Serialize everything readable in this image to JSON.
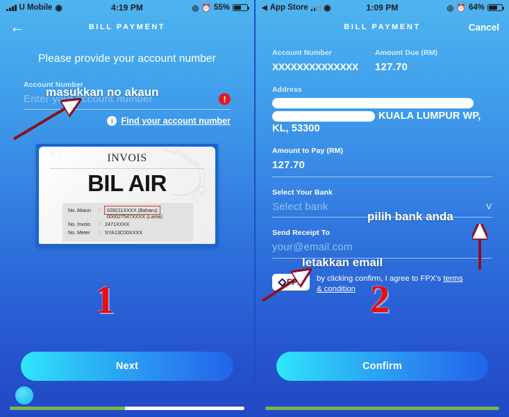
{
  "left": {
    "status": {
      "carrier": "U Mobile",
      "time": "4:19 PM",
      "battery": "55%",
      "wifi_icon": "wifi-icon",
      "signal_icon": "signal-bars-icon",
      "battery_icon": "battery-icon",
      "alarm_icon": "alarm-clock-icon",
      "lock_icon": "screen-rotation-lock-icon"
    },
    "nav": {
      "back_icon": "back-arrow-icon",
      "title": "BILL PAYMENT"
    },
    "headline": "Please provide your account number",
    "account": {
      "label": "Account Number",
      "placeholder": "Enter your account number",
      "value": "",
      "error_icon": "error-exclamation-icon"
    },
    "find_link": {
      "info_icon": "info-circle-icon",
      "text": "Find your account number"
    },
    "invoice": {
      "title": "INVOIS",
      "heading": "BIL AIR",
      "rows": [
        {
          "key": "No. Akaun",
          "sep": ":",
          "value": "028211XXXX (Baharu)",
          "value_old": "000027547XXXX (Lama)"
        },
        {
          "key": "No. Invois",
          "sep": ":",
          "value": "2471XXXX"
        },
        {
          "key": "No. Meter",
          "sep": ":",
          "value": "SYA13C00XXXX"
        }
      ]
    },
    "step_number": "1",
    "cta_label": "Next",
    "progress_percent": 49,
    "annotations": [
      {
        "text": "masukkan no akaun",
        "name": "annotation-enter-account-number"
      }
    ]
  },
  "right": {
    "status": {
      "app_back": "App Store",
      "time": "1:09 PM",
      "battery": "64%",
      "wifi_icon": "wifi-icon",
      "signal_icon": "signal-bars-icon",
      "battery_icon": "battery-icon",
      "alarm_icon": "alarm-clock-icon",
      "lock_icon": "screen-rotation-lock-icon",
      "back_triangle_icon": "back-triangle-icon"
    },
    "nav": {
      "title": "BILL PAYMENT",
      "cancel_label": "Cancel"
    },
    "account_number": {
      "label": "Account Number",
      "value": "XXXXXXXXXXXXXX"
    },
    "amount_due": {
      "label": "Amount Due (RM)",
      "value": "127.70"
    },
    "address": {
      "label": "Address",
      "masked_line1": "",
      "masked_prefix": "",
      "line2_text": "KUALA LUMPUR WP,",
      "line3_text": "KL, 53300"
    },
    "amount_to_pay": {
      "label": "Amount to Pay (RM)",
      "value": "127.70"
    },
    "select_bank": {
      "label": "Select Your Bank",
      "placeholder": "Select bank",
      "value": "",
      "chevron_icon": "chevron-down-icon"
    },
    "send_receipt": {
      "label": "Send Receipt To",
      "placeholder": "your@email.com",
      "value": ""
    },
    "fpx": {
      "logo_text": "FPX",
      "logo_icon": "fpx-diamond-icon",
      "terms_prefix": "by clicking confirm, I agree to FPX's ",
      "terms_link": "terms & condition"
    },
    "step_number": "2",
    "cta_label": "Confirm",
    "progress_percent": 100,
    "annotations": [
      {
        "text": "pilih bank anda",
        "name": "annotation-choose-your-bank"
      },
      {
        "text": "letakkan email",
        "name": "annotation-put-email"
      }
    ]
  },
  "colors": {
    "accent_cyan": "#2fe6fb",
    "accent_blue": "#2163ea",
    "error_red": "#e01b1b",
    "annotation_red": "#a01220",
    "progress_green": "#7bb34a"
  }
}
